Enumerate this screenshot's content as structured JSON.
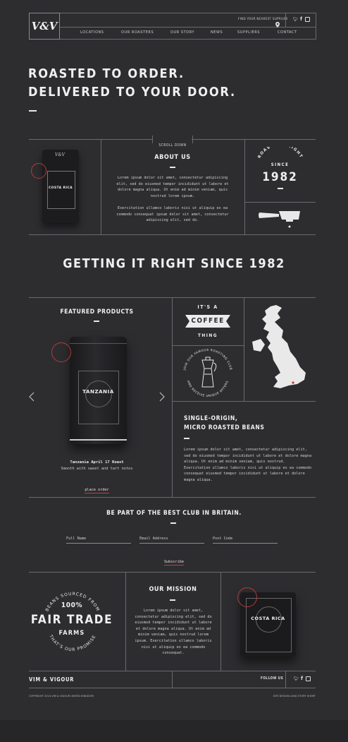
{
  "header": {
    "logo": "V&V",
    "supplier_link": "FIND YOUR NEAREST SUPPLIER",
    "nav": [
      "LOCATIONS",
      "OUR ROASTERS",
      "OUR STORY",
      "NEWS",
      "SUPPLIERS",
      "CONTACT"
    ],
    "social_icons": [
      "twitter-icon",
      "facebook-icon",
      "instagram-icon"
    ]
  },
  "hero": {
    "line1": "ROASTED TO ORDER.",
    "line2": "DELIVERED TO YOUR DOOR."
  },
  "scroll_down": "SCROLL DOWN",
  "about": {
    "title": "ABOUT US",
    "para1": "Lorem ipsum dolor sit amet, consectetur adipiscing elit, sed do eiusmod tempor incididunt ut labore et dolore magna aliqua. Ut enim ad minim veniam, quis nostrud lorem ipsum.",
    "para2": "Exercitation ullamco laboris nisi ut aliquip ex ea commodo consequat ipsum dolor sit amet, consectetur adipiscing elit, sed do.",
    "bag_label": "COSTA RICA",
    "roasting_top": "ROASTING RIGHT",
    "since": "SINCE",
    "year": "1982"
  },
  "tagline": "GETTING IT RIGHT SINCE 1982",
  "featured": {
    "title": "FEATURED PRODUCTS",
    "product_label": "TANZANIA",
    "product_name": "Tanzania April 17 Roast",
    "product_desc": "Smooth with sweet and tart notes",
    "cta": "place order"
  },
  "coffee_badge": {
    "top": "IT'S A",
    "middle": "COFFEE",
    "bottom": "THING"
  },
  "club_circle": {
    "top": "JOIN OUR FAMOUS ROASTING CLUB",
    "bottom": "AND RECEIVE UNIQUE OFFERS"
  },
  "single_origin": {
    "title1": "SINGLE-ORIGIN,",
    "title2": "MICRO ROASTED BEANS",
    "text": "Lorem ipsum dolor sit amet, consectetur adipiscing elit, sed do eiusmod tempor incididunt ut labore et dolore magna aliqua. Ut enim ad minim veniam, quis nostrud. Exercitation ullamco laboris nisi ut aliquip ex ea commodo consequat eiusmod tempor incididunt ut labore et dolore magna aliqua."
  },
  "club": {
    "title": "BE PART OF THE BEST CLUB IN BRITAIN.",
    "fields": [
      "Full Name",
      "Email Address",
      "Post Code"
    ],
    "subscribe": "Subscribe"
  },
  "fairtrade": {
    "top": "BEANS SOURCED FROM",
    "pct": "100%",
    "line1": "FAIR TRADE",
    "line2": "FARMS",
    "bottom": "THAT'S OUR PROMISE"
  },
  "mission": {
    "title": "OUR MISSION",
    "text": "Lorem ipsum dolor sit amet, consectetur adipiscing elit, sed do eiusmod tempor incididunt ut labore et dolore magna aliqua. Ut enim ad minim veniam, quis nostrud lorem ipsum. Exercitation ullamco laboris nisi ut aliquip ex ea commodo consequat.",
    "tin_label": "COSTA RICA"
  },
  "footer": {
    "brand": "VIM & VIGOUR",
    "follow": "FOLLOW US",
    "copyright": "COPYRIGHT 2014 VIM & VIGOUR UNITED KINGDOM",
    "credit": "SITE DESIGN LONG STORY SHORT"
  }
}
